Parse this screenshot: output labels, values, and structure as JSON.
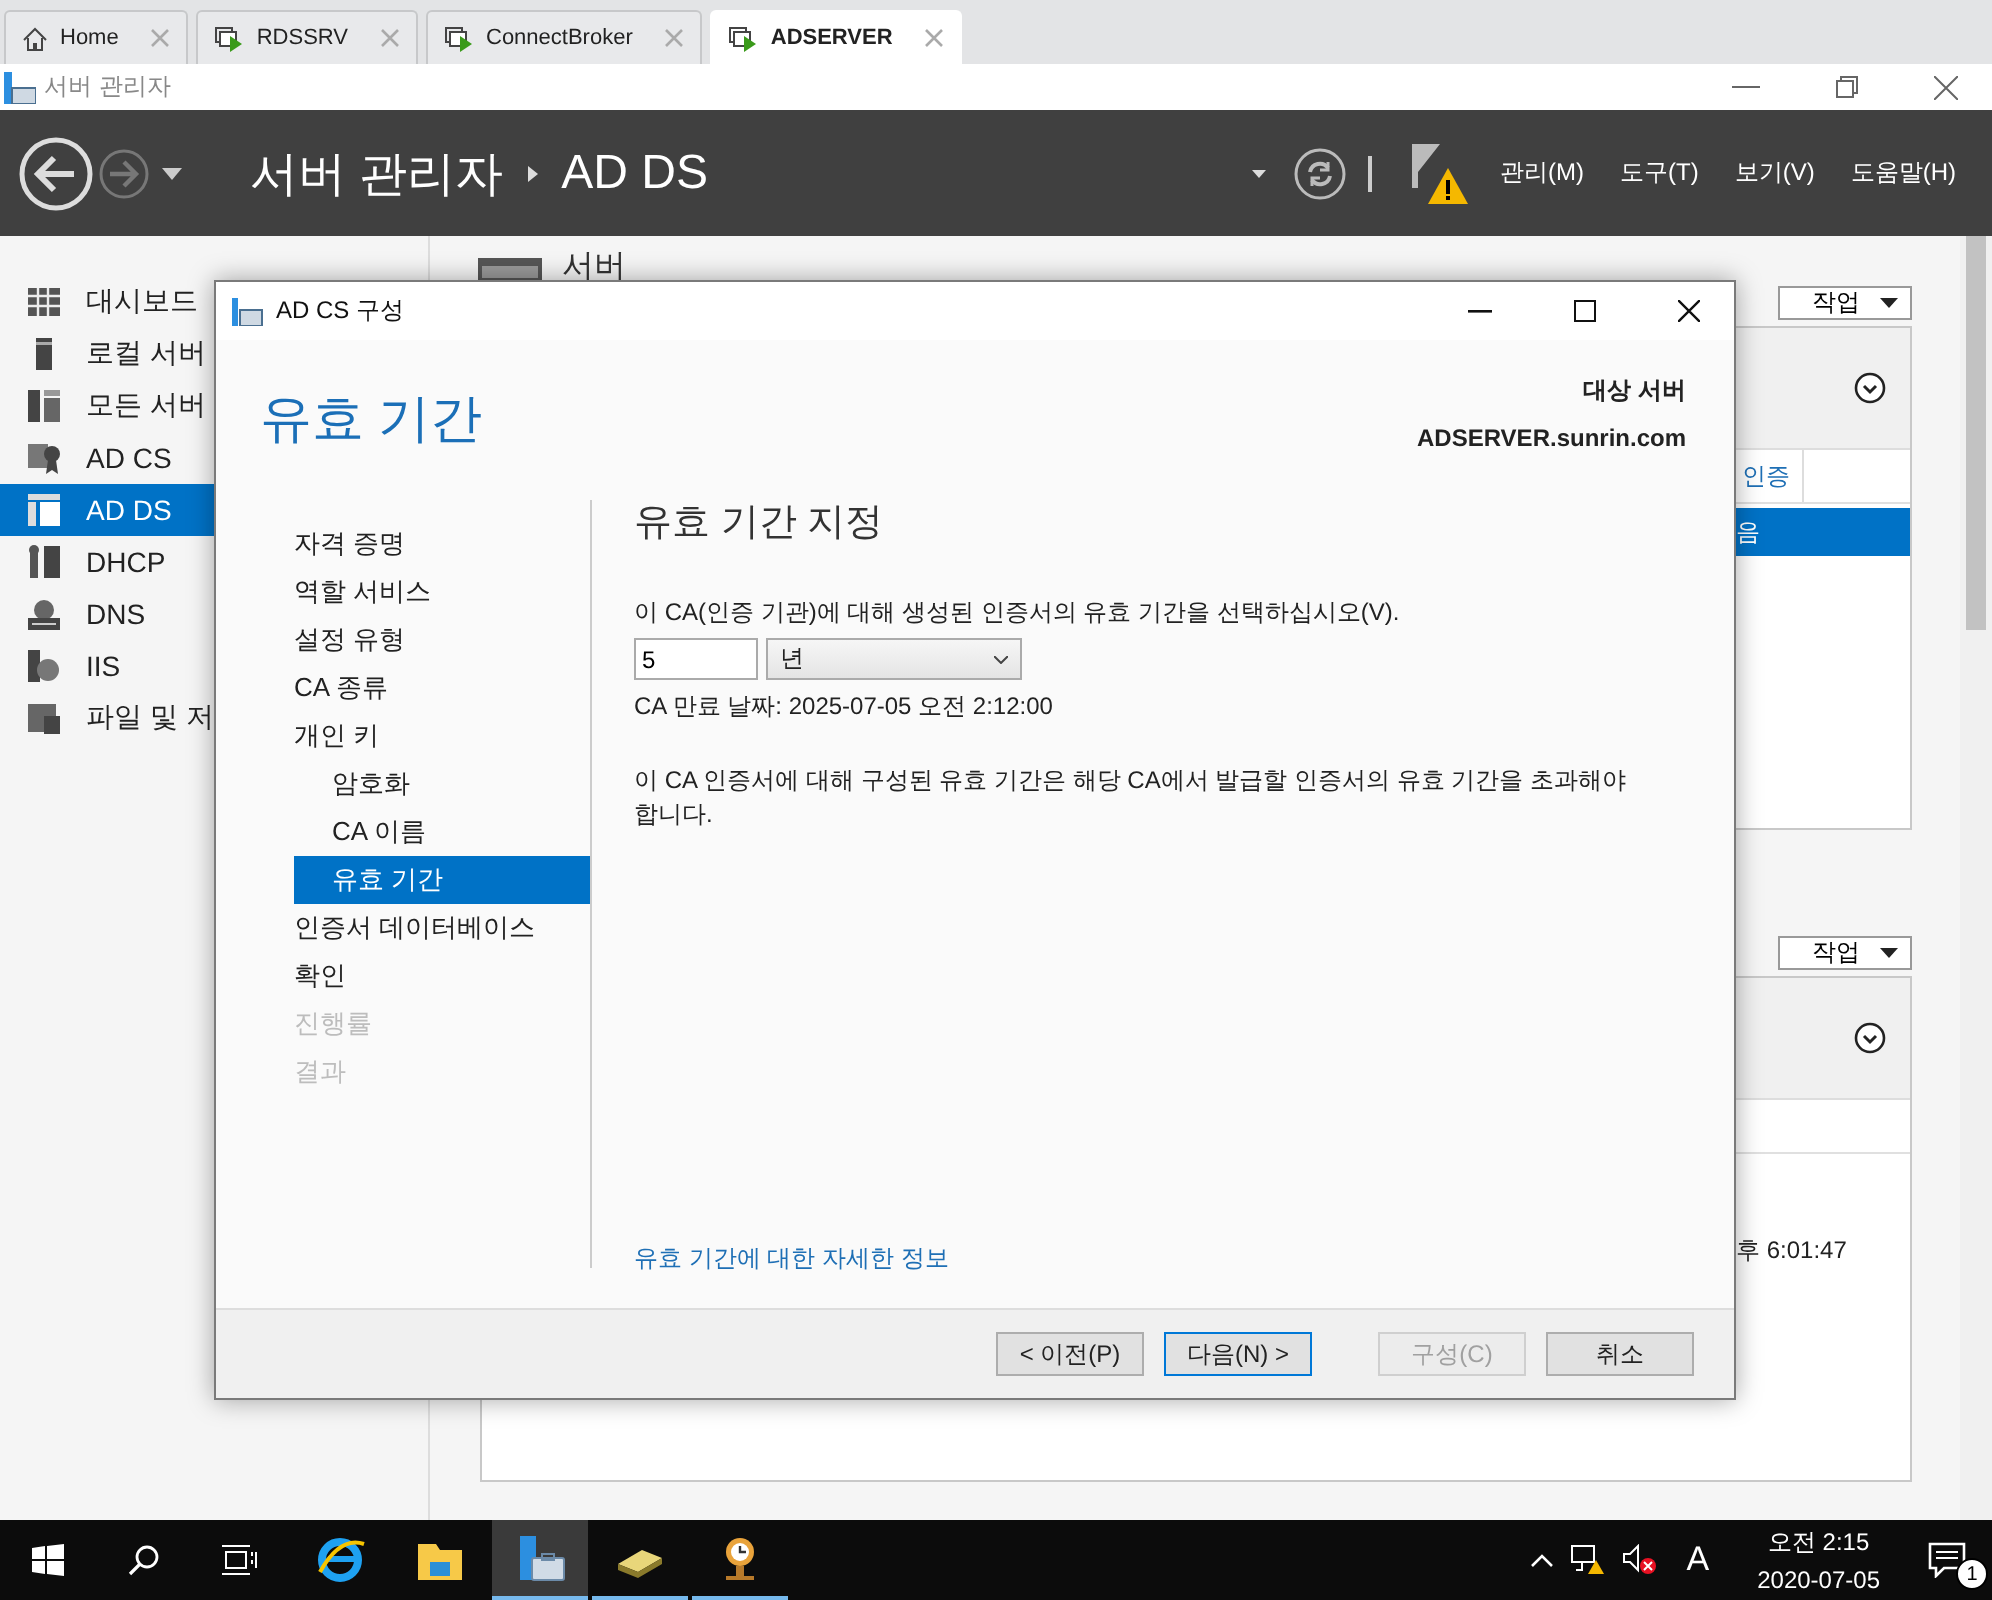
{
  "browser_tabs": [
    {
      "label": "Home",
      "selected": false
    },
    {
      "label": "RDSSRV",
      "selected": false
    },
    {
      "label": "ConnectBroker",
      "selected": false
    },
    {
      "label": "ADSERVER",
      "selected": true
    }
  ],
  "window": {
    "title": "서버 관리자"
  },
  "header": {
    "breadcrumb": [
      "서버 관리자",
      "AD DS"
    ],
    "menus": [
      "관리(M)",
      "도구(T)",
      "보기(V)",
      "도움말(H)"
    ]
  },
  "sidebar": {
    "items": [
      {
        "label": "대시보드",
        "selected": false
      },
      {
        "label": "로컬 서버",
        "selected": false
      },
      {
        "label": "모든 서버",
        "selected": false
      },
      {
        "label": "AD CS",
        "selected": false
      },
      {
        "label": "AD DS",
        "selected": true
      },
      {
        "label": "DHCP",
        "selected": false
      },
      {
        "label": "DNS",
        "selected": false
      },
      {
        "label": "IIS",
        "selected": false
      },
      {
        "label": "파일 및 저",
        "selected": false
      }
    ]
  },
  "content": {
    "heading": "서버",
    "tiles": [
      {
        "task_button": "작업",
        "column_header": "인증",
        "rows": [
          {
            "text": "음",
            "selected": true
          }
        ]
      },
      {
        "task_button": "작업",
        "rows": [
          {
            "text": "후 6:01:47",
            "selected": false
          }
        ]
      }
    ]
  },
  "dialog": {
    "title": "AD CS 구성",
    "page_title": "유효 기간",
    "target_label": "대상 서버",
    "target_server": "ADSERVER.sunrin.com",
    "nav": [
      {
        "label": "자격 증명",
        "selected": false,
        "disabled": false
      },
      {
        "label": "역할 서비스",
        "selected": false,
        "disabled": false
      },
      {
        "label": "설정 유형",
        "selected": false,
        "disabled": false
      },
      {
        "label": "CA 종류",
        "selected": false,
        "disabled": false
      },
      {
        "label": "개인 키",
        "selected": false,
        "disabled": false,
        "children": [
          {
            "label": "암호화",
            "selected": false,
            "disabled": false
          },
          {
            "label": "CA 이름",
            "selected": false,
            "disabled": false
          },
          {
            "label": "유효 기간",
            "selected": true,
            "disabled": false
          }
        ]
      },
      {
        "label": "인증서 데이터베이스",
        "selected": false,
        "disabled": false
      },
      {
        "label": "확인",
        "selected": false,
        "disabled": false
      },
      {
        "label": "진행률",
        "selected": false,
        "disabled": true
      },
      {
        "label": "결과",
        "selected": false,
        "disabled": true
      }
    ],
    "section_title": "유효 기간 지정",
    "prompt": "이 CA(인증 기관)에 대해 생성된 인증서의 유효 기간을 선택하십시오(V).",
    "validity_value": "5",
    "validity_unit": "년",
    "expiry": "CA 만료 날짜: 2025-07-05 오전 2:12:00",
    "note": "이 CA 인증서에 대해 구성된 유효 기간은 해당 CA에서 발급할 인증서의 유효 기간을 초과해야 합니다.",
    "more_info_link": "유효 기간에 대한 자세한 정보",
    "buttons": [
      {
        "label": "< 이전(P)",
        "disabled": false,
        "default": false
      },
      {
        "label": "다음(N) >",
        "disabled": false,
        "default": true
      },
      {
        "label": "구성(C)",
        "disabled": true,
        "default": false
      },
      {
        "label": "취소",
        "disabled": false,
        "default": false
      }
    ]
  },
  "taskbar": {
    "pinned_apps": [
      {
        "running": false,
        "selected": false
      },
      {
        "running": false,
        "selected": false
      },
      {
        "running": true,
        "selected": true
      },
      {
        "running": true,
        "selected": false
      },
      {
        "running": true,
        "selected": false
      }
    ],
    "input_indicator": "A",
    "time": "오전 2:15",
    "date": "2020-07-05",
    "notification_count": "1"
  }
}
